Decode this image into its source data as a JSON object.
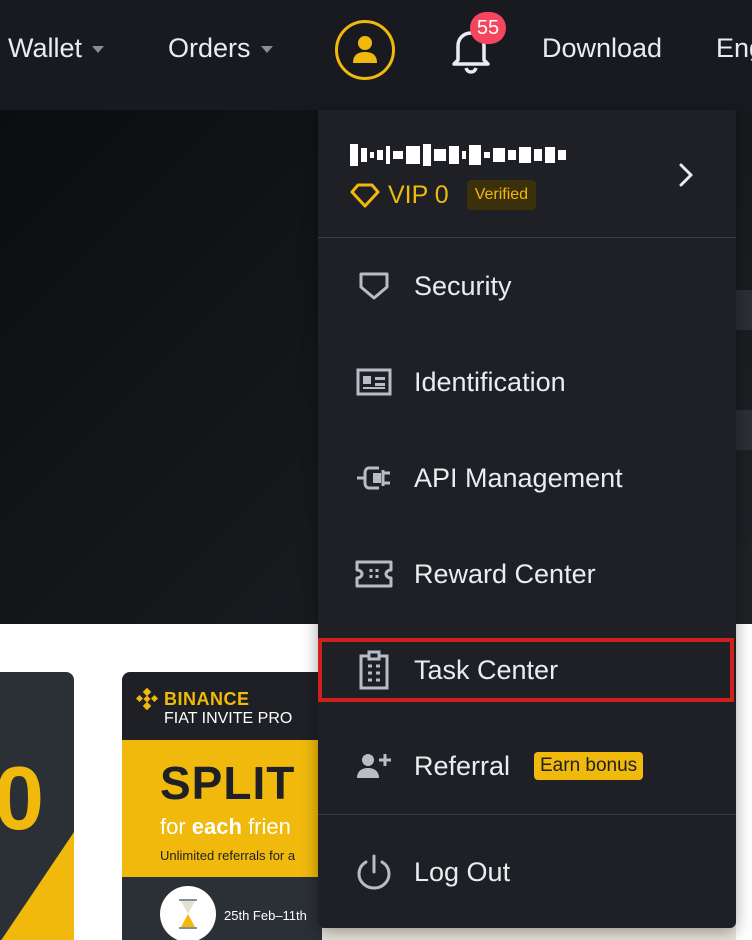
{
  "nav": {
    "wallet": "Wallet",
    "orders": "Orders",
    "notification_count": "55",
    "download": "Download",
    "language": "Eng"
  },
  "account": {
    "vip_level": "VIP 0",
    "verified_label": "Verified"
  },
  "menu": {
    "security": "Security",
    "identification": "Identification",
    "api_management": "API Management",
    "reward_center": "Reward Center",
    "task_center": "Task Center",
    "referral": "Referral",
    "earn_bonus": "Earn bonus",
    "log_out": "Log Out"
  },
  "promo": {
    "brand": "BINANCE",
    "subtitle": "FIAT INVITE PRO",
    "headline": "SPLIT",
    "for_line_prefix": "for ",
    "for_line_bold": "each",
    "for_line_suffix": " frien",
    "unlimited": "Unlimited referrals for a",
    "date": "25th Feb–11th",
    "left_card_digit": "0"
  },
  "colors": {
    "accent": "#f0b90b",
    "background_dark": "#181a20",
    "menu_bg": "#1e2026",
    "badge": "#f6465d",
    "highlight_border": "#d0201e"
  },
  "icons": {
    "avatar": "user-avatar-icon",
    "bell": "bell-icon",
    "diamond": "diamond-icon",
    "chevron": "chevron-right-icon",
    "security": "shield-icon",
    "identification": "id-card-icon",
    "api": "plug-icon",
    "reward": "ticket-icon",
    "task": "clipboard-icon",
    "referral": "add-user-icon",
    "logout": "power-icon"
  }
}
